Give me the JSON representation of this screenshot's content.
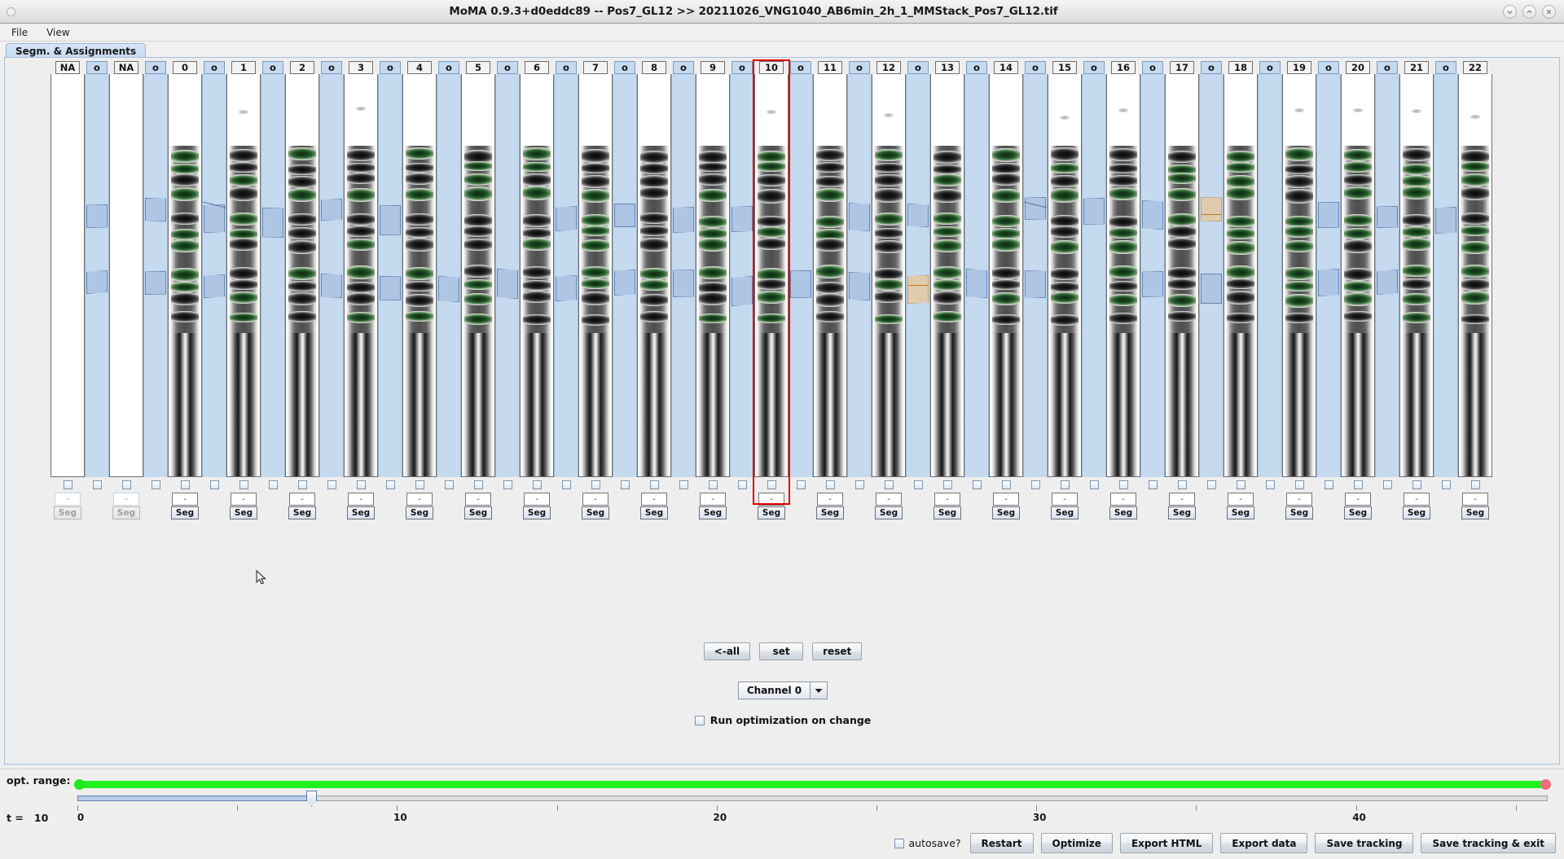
{
  "window": {
    "title": "MoMA 0.9.3+d0eddc89 -- Pos7_GL12 >> 20211026_VNG1040_AB6min_2h_1_MMStack_Pos7_GL12.tif",
    "minimize_icon": "chevron-down-icon",
    "maximize_icon": "chevron-up-icon",
    "close_icon": "close-icon"
  },
  "menubar": {
    "items": [
      {
        "label": "File"
      },
      {
        "label": "View"
      }
    ]
  },
  "tabs": [
    {
      "label": "Segm. & Assignments",
      "selected": true
    }
  ],
  "lanes": {
    "frame_headers": [
      "NA",
      "NA",
      "0",
      "1",
      "2",
      "3",
      "4",
      "5",
      "6",
      "7",
      "8",
      "9",
      "10",
      "11",
      "12",
      "13",
      "14",
      "15",
      "16",
      "17",
      "18",
      "19",
      "20",
      "21",
      "22"
    ],
    "assignment_header": "o",
    "selected_frame": "10",
    "value_placeholder": "-",
    "seg_button_label": "Seg",
    "na_label": "NA"
  },
  "mid_buttons": [
    {
      "label": "<-all",
      "name": "all-button"
    },
    {
      "label": "set",
      "name": "set-button"
    },
    {
      "label": "reset",
      "name": "reset-button"
    }
  ],
  "channel": {
    "selected": "Channel 0",
    "arrow_icon": "chevron-down-icon"
  },
  "run_optimization": {
    "label": "Run optimization on change",
    "checked": false
  },
  "opt_range": {
    "label": "opt. range:",
    "range_color": "#20f020",
    "left_handle_color": "#1ee81e",
    "right_handle_color": "#f06a80"
  },
  "timeline": {
    "t_label": "t =",
    "t_value": "10",
    "tick_labels": [
      "0",
      "10",
      "20",
      "30",
      "40"
    ],
    "tick_positions": [
      0,
      10,
      20,
      30,
      40
    ],
    "current": 10,
    "max": 46
  },
  "bottom_bar": {
    "autosave": {
      "label": "autosave?",
      "checked": false
    },
    "buttons": [
      {
        "label": "Restart",
        "name": "restart-button"
      },
      {
        "label": "Optimize",
        "name": "optimize-button"
      },
      {
        "label": "Export HTML",
        "name": "export-html-button"
      },
      {
        "label": "Export data",
        "name": "export-data-button"
      },
      {
        "label": "Save tracking",
        "name": "save-tracking-button"
      },
      {
        "label": "Save tracking & exit",
        "name": "save-tracking-exit-button"
      }
    ]
  },
  "colors": {
    "assignment_band": "#c5d9ef",
    "assignment_poly": "#aabfe0",
    "assignment_poly_highlight": "#e8c89a",
    "selection": "#e00000",
    "panel": "#eeeeee"
  }
}
